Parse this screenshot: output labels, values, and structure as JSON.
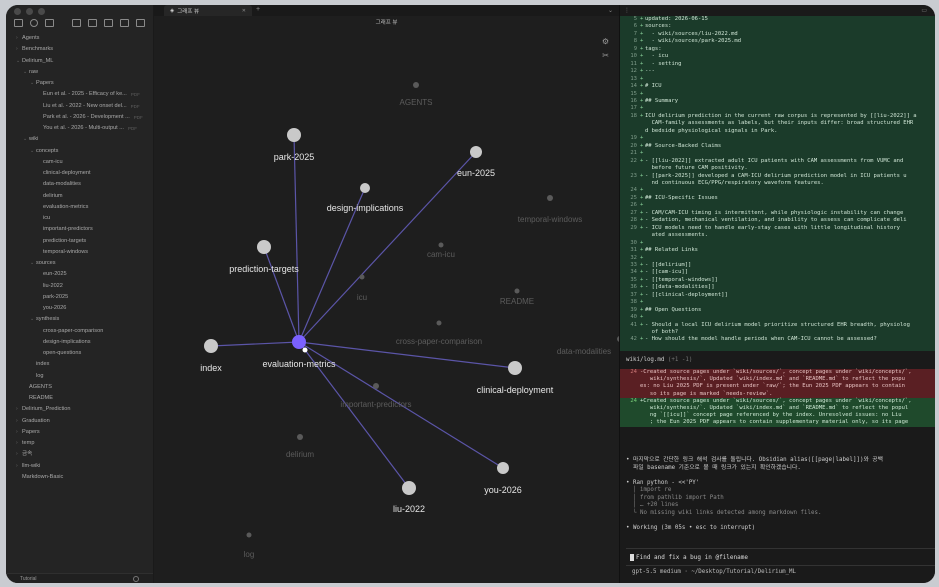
{
  "sidebar": {
    "tree": [
      {
        "label": "Agents",
        "indent": 0,
        "caret": "›"
      },
      {
        "label": "Benchmarks",
        "indent": 0,
        "caret": "›"
      },
      {
        "label": "Delirium_ML",
        "indent": 0,
        "caret": "⌄"
      },
      {
        "label": "raw",
        "indent": 1,
        "caret": "⌄"
      },
      {
        "label": "Papers",
        "indent": 2,
        "caret": "⌄"
      },
      {
        "label": "Eun et al. - 2025 - Efficacy of ke...",
        "indent": 3,
        "caret": "",
        "tag": "PDF"
      },
      {
        "label": "Liu et al. - 2022 - New onset del...",
        "indent": 3,
        "caret": "",
        "tag": "PDF"
      },
      {
        "label": "Park et al. - 2026 - Development ...",
        "indent": 3,
        "caret": "",
        "tag": "PDF"
      },
      {
        "label": "You et al. - 2026 - Multi-output ...",
        "indent": 3,
        "caret": "",
        "tag": "PDF"
      },
      {
        "label": "wiki",
        "indent": 1,
        "caret": "⌄"
      },
      {
        "label": "concepts",
        "indent": 2,
        "caret": "⌄"
      },
      {
        "label": "cam-icu",
        "indent": 3,
        "caret": ""
      },
      {
        "label": "clinical-deployment",
        "indent": 3,
        "caret": ""
      },
      {
        "label": "data-modalities",
        "indent": 3,
        "caret": ""
      },
      {
        "label": "delirium",
        "indent": 3,
        "caret": ""
      },
      {
        "label": "evaluation-metrics",
        "indent": 3,
        "caret": ""
      },
      {
        "label": "icu",
        "indent": 3,
        "caret": ""
      },
      {
        "label": "important-predictors",
        "indent": 3,
        "caret": ""
      },
      {
        "label": "prediction-targets",
        "indent": 3,
        "caret": ""
      },
      {
        "label": "temporal-windows",
        "indent": 3,
        "caret": ""
      },
      {
        "label": "sources",
        "indent": 2,
        "caret": "⌄"
      },
      {
        "label": "eun-2025",
        "indent": 3,
        "caret": ""
      },
      {
        "label": "liu-2022",
        "indent": 3,
        "caret": ""
      },
      {
        "label": "park-2025",
        "indent": 3,
        "caret": ""
      },
      {
        "label": "you-2026",
        "indent": 3,
        "caret": ""
      },
      {
        "label": "synthesis",
        "indent": 2,
        "caret": "⌄"
      },
      {
        "label": "cross-paper-comparison",
        "indent": 3,
        "caret": ""
      },
      {
        "label": "design-implications",
        "indent": 3,
        "caret": ""
      },
      {
        "label": "open-questions",
        "indent": 3,
        "caret": ""
      },
      {
        "label": "index",
        "indent": 2,
        "caret": ""
      },
      {
        "label": "log",
        "indent": 2,
        "caret": ""
      },
      {
        "label": "AGENTS",
        "indent": 1,
        "caret": ""
      },
      {
        "label": "README",
        "indent": 1,
        "caret": ""
      },
      {
        "label": "Delirium_Prediction",
        "indent": 0,
        "caret": "›"
      },
      {
        "label": "Graduation",
        "indent": 0,
        "caret": "›"
      },
      {
        "label": "Papers",
        "indent": 0,
        "caret": "›"
      },
      {
        "label": "temp",
        "indent": 0,
        "caret": "›"
      },
      {
        "label": "금속",
        "indent": 0,
        "caret": "›"
      },
      {
        "label": "llm-wiki",
        "indent": 0,
        "caret": "›"
      },
      {
        "label": "Markdown-Basic",
        "indent": 0,
        "caret": ""
      }
    ],
    "footer_label": "Tutorial"
  },
  "tabs": {
    "active_label": "그래프 뷰",
    "graph_title": "그래프 뷰"
  },
  "graph": {
    "edge_color": "#5b55a8",
    "active_color": "#7b61ff",
    "node_color": "#c9c9c9",
    "dim_node_color": "#5a5a5a",
    "nodes": [
      {
        "id": "evaluation-metrics",
        "label": "evaluation-metrics",
        "active": true
      },
      {
        "id": "park-2025",
        "label": "park-2025"
      },
      {
        "id": "eun-2025",
        "label": "eun-2025"
      },
      {
        "id": "design-implications",
        "label": "design-implications"
      },
      {
        "id": "prediction-targets",
        "label": "prediction-targets"
      },
      {
        "id": "index",
        "label": "index"
      },
      {
        "id": "clinical-deployment",
        "label": "clinical-deployment"
      },
      {
        "id": "you-2026",
        "label": "you-2026"
      },
      {
        "id": "liu-2022",
        "label": "liu-2022"
      },
      {
        "id": "AGENTS",
        "label": "AGENTS",
        "dim": true
      },
      {
        "id": "temporal-windows",
        "label": "temporal-windows",
        "dim": true
      },
      {
        "id": "cam-icu",
        "label": "cam-icu",
        "dim": true
      },
      {
        "id": "icu",
        "label": "icu",
        "dim": true
      },
      {
        "id": "README",
        "label": "README",
        "dim": true
      },
      {
        "id": "cross-paper-comparison",
        "label": "cross-paper-comparison",
        "dim": true
      },
      {
        "id": "data-modalities",
        "label": "data-modalities",
        "dim": true
      },
      {
        "id": "important-predictors",
        "label": "important-predictors",
        "dim": true
      },
      {
        "id": "delirium",
        "label": "delirium",
        "dim": true
      },
      {
        "id": "log",
        "label": "log",
        "dim": true
      }
    ],
    "edges": [
      [
        "evaluation-metrics",
        "park-2025"
      ],
      [
        "evaluation-metrics",
        "eun-2025"
      ],
      [
        "evaluation-metrics",
        "design-implications"
      ],
      [
        "evaluation-metrics",
        "prediction-targets"
      ],
      [
        "evaluation-metrics",
        "index"
      ],
      [
        "evaluation-metrics",
        "clinical-deployment"
      ],
      [
        "evaluation-metrics",
        "you-2026"
      ],
      [
        "evaluation-metrics",
        "liu-2022"
      ]
    ]
  },
  "editor": {
    "lines": [
      {
        "n": "5",
        "text": "updated: 2026-06-15"
      },
      {
        "n": "6",
        "text": "sources:"
      },
      {
        "n": "7",
        "text": "  - wiki/sources/liu-2022.md"
      },
      {
        "n": "8",
        "text": "  - wiki/sources/park-2025.md"
      },
      {
        "n": "9",
        "text": "tags:"
      },
      {
        "n": "10",
        "text": "  - icu"
      },
      {
        "n": "11",
        "text": "  - setting"
      },
      {
        "n": "12",
        "text": "---"
      },
      {
        "n": "13",
        "text": ""
      },
      {
        "n": "14",
        "text": "# ICU"
      },
      {
        "n": "15",
        "text": ""
      },
      {
        "n": "16",
        "text": "## Summary"
      },
      {
        "n": "17",
        "text": ""
      },
      {
        "n": "18",
        "text": "ICU delirium prediction in the current raw corpus is represented by [[liu-2022]] a"
      },
      {
        "n": "",
        "text": "  CAM-family assessments as labels, but their inputs differ: broad structured EHR"
      },
      {
        "n": "",
        "text": "d bedside physiological signals in Park."
      },
      {
        "n": "19",
        "text": ""
      },
      {
        "n": "20",
        "text": "## Source-Backed Claims"
      },
      {
        "n": "21",
        "text": ""
      },
      {
        "n": "22",
        "text": "- [[liu-2022]] extracted adult ICU patients with CAM assessments from VUMC and"
      },
      {
        "n": "",
        "text": "  before future CAM positivity."
      },
      {
        "n": "23",
        "text": "- [[park-2025]] developed a CAM-ICU delirium prediction model in ICU patients u"
      },
      {
        "n": "",
        "text": "  nd continuous ECG/PPG/respiratory waveform features."
      },
      {
        "n": "24",
        "text": ""
      },
      {
        "n": "25",
        "text": "## ICU-Specific Issues"
      },
      {
        "n": "26",
        "text": ""
      },
      {
        "n": "27",
        "text": "- CAM/CAM-ICU timing is intermittent, while physiologic instability can change"
      },
      {
        "n": "28",
        "text": "- Sedation, mechanical ventilation, and inability to assess can complicate deli"
      },
      {
        "n": "29",
        "text": "- ICU models need to handle early-stay cases with little longitudinal history"
      },
      {
        "n": "",
        "text": "  ated assessments."
      },
      {
        "n": "30",
        "text": ""
      },
      {
        "n": "31",
        "text": "## Related Links"
      },
      {
        "n": "32",
        "text": ""
      },
      {
        "n": "33",
        "text": "- [[delirium]]"
      },
      {
        "n": "34",
        "text": "- [[cam-icu]]"
      },
      {
        "n": "35",
        "text": "- [[temporal-windows]]"
      },
      {
        "n": "36",
        "text": "- [[data-modalities]]"
      },
      {
        "n": "37",
        "text": "- [[clinical-deployment]]"
      },
      {
        "n": "38",
        "text": ""
      },
      {
        "n": "39",
        "text": "## Open Questions"
      },
      {
        "n": "40",
        "text": ""
      },
      {
        "n": "41",
        "text": "- Should a local ICU delirium model prioritize structured EHR breadth, physiolog"
      },
      {
        "n": "",
        "text": "  of both?"
      },
      {
        "n": "42",
        "text": "- How should the model handle periods when CAM-ICU cannot be assessed?"
      }
    ]
  },
  "log": {
    "title": "wiki/log.md",
    "counts": "(+1 -1)",
    "lines": [
      {
        "n": "24",
        "kind": "del",
        "text": "-Created source pages under `wiki/sources/`, concept pages under `wiki/concepts/`,"
      },
      {
        "n": "",
        "kind": "del",
        "text": "   wiki/synthesis/`, Updated `wiki/index.md` and `README.md` to reflect the popu"
      },
      {
        "n": "",
        "kind": "del",
        "text": "es: no Liu 2025 PDF is present under `raw/`; the Eun 2025 PDF appears to contain"
      },
      {
        "n": "",
        "kind": "del",
        "text": "   so its page is marked `needs-review`."
      },
      {
        "n": "24",
        "kind": "add",
        "text": "+Created source pages under `wiki/sources/`, concept pages under `wiki/concepts/`,"
      },
      {
        "n": "",
        "kind": "add",
        "text": "   wiki/synthesis/`. Updated `wiki/index.md` and `README.md` to reflect the popul"
      },
      {
        "n": "",
        "kind": "add",
        "text": "   ng `[[icu]]` concept page referenced by the index. Unresolved issues: no Liu"
      },
      {
        "n": "",
        "kind": "add",
        "text": "   ; the Eun 2025 PDF appears to contain supplementary material only, so its page"
      }
    ]
  },
  "terminal": {
    "lines": [
      {
        "kind": "bullet",
        "text": "• 마지막으로 간단한 링크 해석 검사를 돌립니다. Obsidian alias([[page|label]])와 공백"
      },
      {
        "kind": "plain",
        "text": "  파일 basename 기준으로 볼 때 링크가 있는지 확인하겠습니다."
      },
      {
        "kind": "plain",
        "text": ""
      },
      {
        "kind": "bullet",
        "text": "• Ran python - <<'PY'"
      },
      {
        "kind": "dim",
        "text": "  │ import re"
      },
      {
        "kind": "dim",
        "text": "  │ from pathlib import Path"
      },
      {
        "kind": "dim",
        "text": "  │ … +20 lines"
      },
      {
        "kind": "dim",
        "text": "  └ No missing wiki links detected among markdown files."
      },
      {
        "kind": "plain",
        "text": ""
      },
      {
        "kind": "bullet",
        "text": "• Working (3m 05s • esc to interrupt)"
      }
    ],
    "input_text": "Find and fix a bug in @filename",
    "status_text": "gpt-5.5 medium · ~/Desktop/Tutorial/Delirium_ML"
  }
}
